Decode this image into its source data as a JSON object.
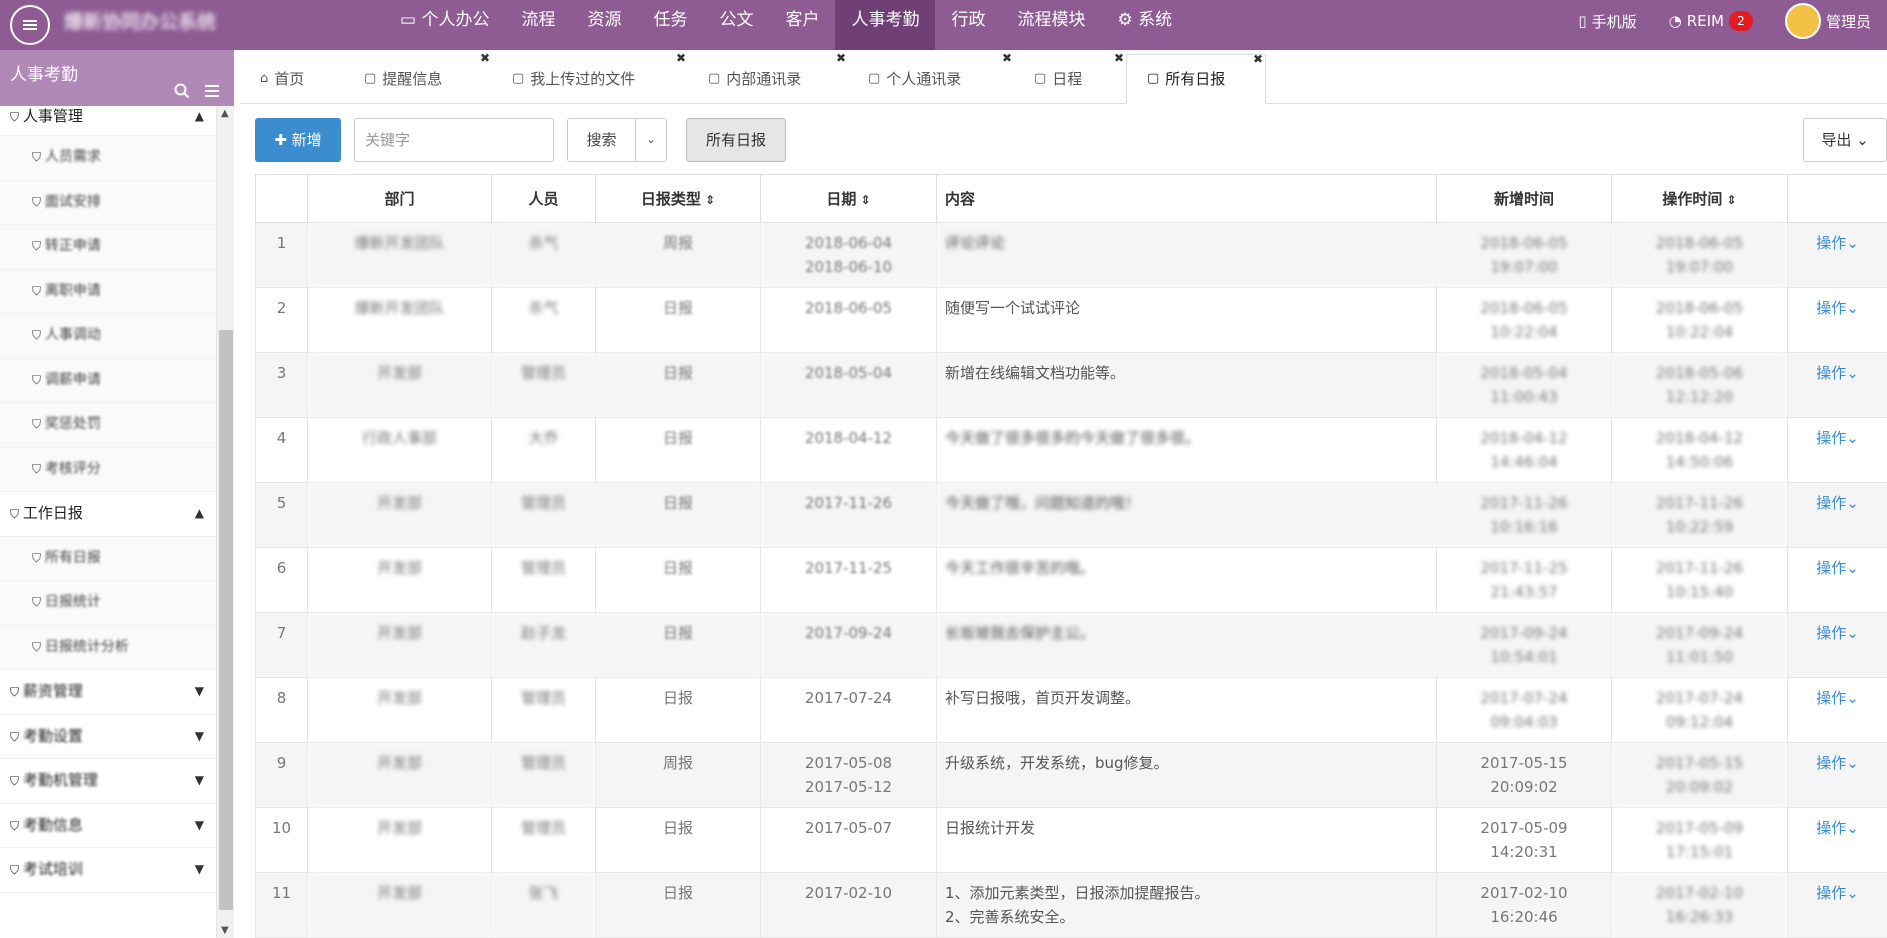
{
  "app": {
    "title": "爆新协同办公系统",
    "nav": [
      "个人办公",
      "流程",
      "资源",
      "任务",
      "公文",
      "客户",
      "人事考勤",
      "行政",
      "流程模块",
      "系统"
    ],
    "active_nav": "人事考勤",
    "right": {
      "mobile": "手机版",
      "im": "REIM",
      "im_badge": "2",
      "user": "管理员"
    },
    "colors": {
      "topbar": "#8e5c93",
      "sidebar_head": "#b089b6",
      "primary": "#3c8dd0"
    }
  },
  "sidebar": {
    "header": "人事考勤",
    "items": [
      {
        "label": "人事管理",
        "type": "group",
        "arrow": "▲"
      },
      {
        "label": "人员需求",
        "type": "sub"
      },
      {
        "label": "面试安排",
        "type": "sub"
      },
      {
        "label": "转正申请",
        "type": "sub"
      },
      {
        "label": "离职申请",
        "type": "sub"
      },
      {
        "label": "人事调动",
        "type": "sub"
      },
      {
        "label": "调薪申请",
        "type": "sub"
      },
      {
        "label": "奖惩处罚",
        "type": "sub"
      },
      {
        "label": "考核评分",
        "type": "sub"
      },
      {
        "label": "工作日报",
        "type": "group",
        "arrow": "▲"
      },
      {
        "label": "所有日报",
        "type": "sub"
      },
      {
        "label": "日报统计",
        "type": "sub"
      },
      {
        "label": "日报统计分析",
        "type": "sub"
      },
      {
        "label": "薪资管理",
        "type": "group",
        "arrow": "▼"
      },
      {
        "label": "考勤设置",
        "type": "group",
        "arrow": "▼"
      },
      {
        "label": "考勤机管理",
        "type": "group",
        "arrow": "▼"
      },
      {
        "label": "考勤信息",
        "type": "group",
        "arrow": "▼"
      },
      {
        "label": "考试培训",
        "type": "group",
        "arrow": "▼"
      }
    ]
  },
  "tabs": [
    {
      "label": "首页",
      "closable": false
    },
    {
      "label": "提醒信息",
      "closable": true
    },
    {
      "label": "我上传过的文件",
      "closable": true
    },
    {
      "label": "内部通讯录",
      "closable": true
    },
    {
      "label": "个人通讯录",
      "closable": true
    },
    {
      "label": "日程",
      "closable": true
    },
    {
      "label": "所有日报",
      "closable": true,
      "active": true
    }
  ],
  "toolbar": {
    "new": "新增",
    "keyword_placeholder": "关键字",
    "search": "搜索",
    "all": "所有日报",
    "export": "导出"
  },
  "table": {
    "headers": [
      "",
      "部门",
      "人员",
      "日报类型",
      "日期",
      "内容",
      "新增时间",
      "操作时间",
      ""
    ],
    "sortable": [
      false,
      false,
      false,
      true,
      true,
      false,
      false,
      true,
      false
    ],
    "rows": [
      {
        "idx": "1",
        "dept": "爆新开发团队",
        "person": "杀气",
        "type": "周报",
        "date1": "2018-06-04",
        "date2": "2018-06-10",
        "content1": "评论评论",
        "content2": "",
        "add1": "2018-06-05",
        "add2": "19:07:00",
        "op1": "2018-06-05",
        "op2": "19:07:00",
        "action": "操作"
      },
      {
        "idx": "2",
        "dept": "爆新开发团队",
        "person": "杀气",
        "type": "日报",
        "date1": "2018-06-05",
        "date2": "",
        "content1": "随便写一个试试评论",
        "content2": "",
        "add1": "2018-06-05",
        "add2": "10:22:04",
        "op1": "2018-06-05",
        "op2": "10:22:04",
        "action": "操作"
      },
      {
        "idx": "3",
        "dept": "开发部",
        "person": "管理员",
        "type": "日报",
        "date1": "2018-05-04",
        "date2": "",
        "content1": "新增在线编辑文档功能等。",
        "content2": "",
        "add1": "2018-05-04",
        "add2": "11:00:43",
        "op1": "2018-05-06",
        "op2": "12:12:20",
        "action": "操作"
      },
      {
        "idx": "4",
        "dept": "行政人事部",
        "person": "大乔",
        "type": "日报",
        "date1": "2018-04-12",
        "date2": "",
        "content1": "今天做了很多很多的今天做了很多很。",
        "content2": "",
        "add1": "2018-04-12",
        "add2": "14:46:04",
        "op1": "2018-04-12",
        "op2": "14:50:06",
        "action": "操作"
      },
      {
        "idx": "5",
        "dept": "开发部",
        "person": "管理员",
        "type": "日报",
        "date1": "2017-11-26",
        "date2": "",
        "content1": "今天做了哦，问题知道的哦！",
        "content2": "",
        "add1": "2017-11-26",
        "add2": "10:16:16",
        "op1": "2017-11-26",
        "op2": "10:22:59",
        "action": "操作"
      },
      {
        "idx": "6",
        "dept": "开发部",
        "person": "管理员",
        "type": "日报",
        "date1": "2017-11-25",
        "date2": "",
        "content1": "今天工作很辛苦的哦。",
        "content2": "",
        "add1": "2017-11-25",
        "add2": "21:43:57",
        "op1": "2017-11-26",
        "op2": "10:15:40",
        "action": "操作"
      },
      {
        "idx": "7",
        "dept": "开发部",
        "person": "赵子龙",
        "type": "日报",
        "date1": "2017-09-24",
        "date2": "",
        "content1": "长坂坡我去保护主公。",
        "content2": "",
        "add1": "2017-09-24",
        "add2": "10:54:01",
        "op1": "2017-09-24",
        "op2": "11:01:50",
        "action": "操作"
      },
      {
        "idx": "8",
        "dept": "开发部",
        "person": "管理员",
        "type": "日报",
        "date1": "2017-07-24",
        "date2": "",
        "content1": "补写日报哦，首页开发调整。",
        "content2": "",
        "add1": "2017-07-24",
        "add2": "09:04:03",
        "op1": "2017-07-24",
        "op2": "09:12:04",
        "action": "操作"
      },
      {
        "idx": "9",
        "dept": "开发部",
        "person": "管理员",
        "type": "周报",
        "date1": "2017-05-08",
        "date2": "2017-05-12",
        "content1": "升级系统，开发系统，bug修复。",
        "content2": "",
        "add1": "2017-05-15",
        "add2": "20:09:02",
        "op1": "2017-05-15",
        "op2": "20:09:02",
        "action": "操作"
      },
      {
        "idx": "10",
        "dept": "开发部",
        "person": "管理员",
        "type": "日报",
        "date1": "2017-05-07",
        "date2": "",
        "content1": "日报统计开发",
        "content2": "",
        "add1": "2017-05-09",
        "add2": "14:20:31",
        "op1": "2017-05-09",
        "op2": "17:15:01",
        "action": "操作"
      },
      {
        "idx": "11",
        "dept": "开发部",
        "person": "张飞",
        "type": "日报",
        "date1": "2017-02-10",
        "date2": "",
        "content1": "1、添加元素类型，日报添加提醒报告。",
        "content2": "2、完善系统安全。",
        "add1": "2017-02-10",
        "add2": "16:20:46",
        "op1": "2017-02-10",
        "op2": "16:26:33",
        "action": "操作"
      }
    ]
  }
}
